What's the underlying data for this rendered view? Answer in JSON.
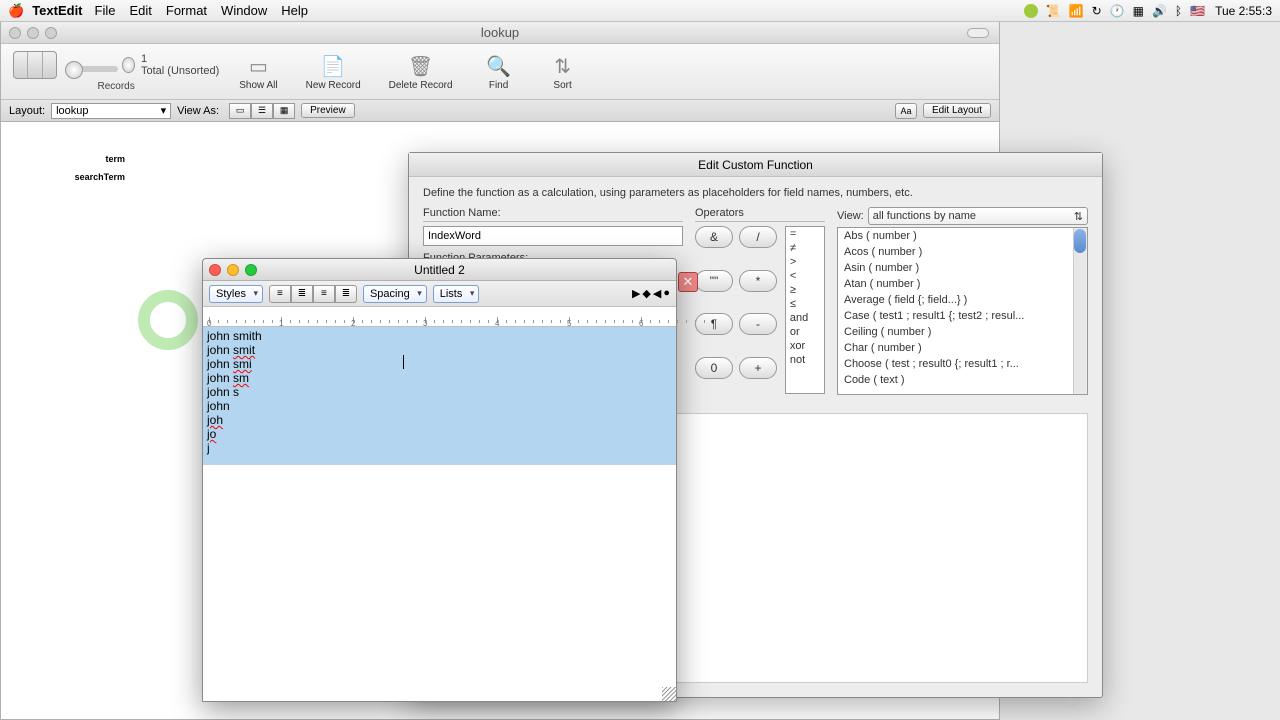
{
  "menubar": {
    "app": "TextEdit",
    "items": [
      "File",
      "Edit",
      "Format",
      "Window",
      "Help"
    ],
    "clock": "Tue 2:55:3"
  },
  "filemaker": {
    "title": "lookup",
    "toolbar": {
      "record_num": "1",
      "total": "Total (Unsorted)",
      "records_label": "Records",
      "show_all": "Show All",
      "new_record": "New Record",
      "delete_record": "Delete Record",
      "find": "Find",
      "sort": "Sort"
    },
    "layoutbar": {
      "layout_label": "Layout:",
      "layout_value": "lookup",
      "view_as": "View As:",
      "preview": "Preview",
      "aa": "Aa",
      "edit_layout": "Edit Layout"
    },
    "fields": {
      "term": "term",
      "searchTerm": "searchTerm"
    }
  },
  "ecf": {
    "title": "Edit Custom Function",
    "desc": "Define the function as a calculation, using parameters as placeholders for field names, numbers, etc.",
    "fn_name_label": "Function Name:",
    "fn_name": "IndexWord",
    "fn_params_label": "Function Parameters:",
    "operators_label": "Operators",
    "view_label": "View:",
    "view_value": "all functions by name",
    "op_buttons": [
      "&",
      "/",
      "\"\"",
      "*",
      "¶",
      "-",
      "0",
      "+"
    ],
    "op_list": [
      "=",
      "≠",
      ">",
      "<",
      "≥",
      "≤",
      "and",
      "or",
      "xor",
      "not"
    ],
    "fn_list": [
      "Abs ( number )",
      "Acos ( number )",
      "Asin ( number )",
      "Atan ( number )",
      "Average ( field {; field...} )",
      "Case ( test1 ; result1 {; test2 ; resul...",
      "Ceiling ( number )",
      "Char ( number )",
      "Choose ( test ; result0 {; result1 ; r...",
      "Code ( text )"
    ]
  },
  "textedit": {
    "title": "Untitled 2",
    "styles": "Styles",
    "spacing": "Spacing",
    "lists": "Lists",
    "ruler_nums": [
      "0",
      "1",
      "2",
      "3",
      "4",
      "5",
      "6"
    ],
    "lines": [
      {
        "plain": "john smith",
        "err": ""
      },
      {
        "plain": "john ",
        "err": "smit"
      },
      {
        "plain": "john ",
        "err": "smi"
      },
      {
        "plain": "john ",
        "err": "sm"
      },
      {
        "plain": "john s",
        "err": ""
      },
      {
        "plain": "john",
        "err": ""
      },
      {
        "plain": "",
        "err": "joh"
      },
      {
        "plain": "",
        "err": "jo"
      },
      {
        "plain": "j",
        "err": ""
      }
    ]
  }
}
